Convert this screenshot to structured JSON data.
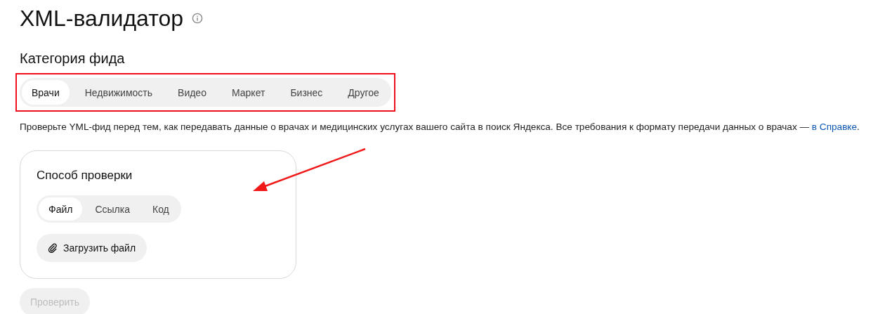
{
  "title": "XML-валидатор",
  "category": {
    "heading": "Категория фида",
    "tabs": [
      {
        "label": "Врачи",
        "selected": true
      },
      {
        "label": "Недвижимость",
        "selected": false
      },
      {
        "label": "Видео",
        "selected": false
      },
      {
        "label": "Маркет",
        "selected": false
      },
      {
        "label": "Бизнес",
        "selected": false
      },
      {
        "label": "Другое",
        "selected": false
      }
    ]
  },
  "description": {
    "text": "Проверьте YML-фид перед тем, как передавать данные о врачах и медицинских услугах вашего сайта в поиск Яндекса. Все требования к формату передачи данных о врачах — ",
    "link": "в Справке",
    "end": "."
  },
  "method": {
    "heading": "Способ проверки",
    "tabs": [
      {
        "label": "Файл",
        "selected": true
      },
      {
        "label": "Ссылка",
        "selected": false
      },
      {
        "label": "Код",
        "selected": false
      }
    ],
    "upload_button": "Загрузить файл"
  },
  "check_button": {
    "label": "Проверить",
    "disabled": true
  }
}
